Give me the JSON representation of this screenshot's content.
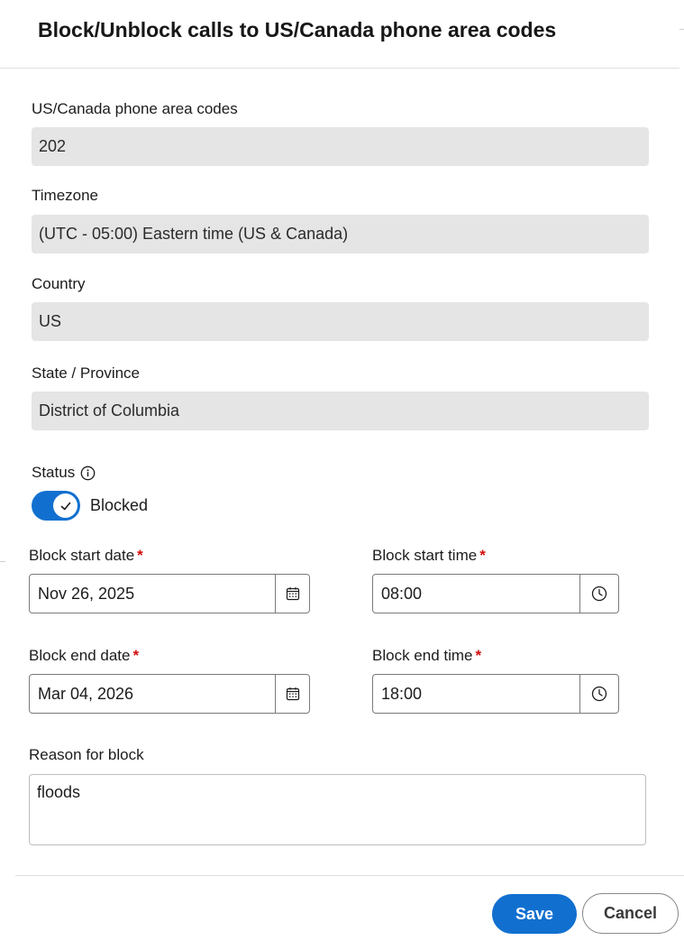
{
  "dialog": {
    "title": "Block/Unblock calls to US/Canada phone area codes"
  },
  "fields": {
    "area_code": {
      "label": "US/Canada phone area codes",
      "value": "202"
    },
    "timezone": {
      "label": "Timezone",
      "value": "(UTC - 05:00) Eastern time (US & Canada)"
    },
    "country": {
      "label": "Country",
      "value": "US"
    },
    "state": {
      "label": "State / Province",
      "value": "District of Columbia"
    }
  },
  "status": {
    "label": "Status",
    "info_icon": "info-icon",
    "toggle_on": true,
    "toggle_text": "Blocked"
  },
  "schedule": {
    "start_date": {
      "label": "Block start date",
      "required_mark": "*",
      "value": "Nov 26, 2025",
      "icon": "calendar-icon"
    },
    "start_time": {
      "label": "Block start time",
      "required_mark": "*",
      "value": "08:00",
      "icon": "clock-icon"
    },
    "end_date": {
      "label": "Block end date",
      "required_mark": "*",
      "value": "Mar 04, 2026",
      "icon": "calendar-icon"
    },
    "end_time": {
      "label": "Block end time",
      "required_mark": "*",
      "value": "18:00",
      "icon": "clock-icon"
    }
  },
  "reason": {
    "label": "Reason for block",
    "value": "floods"
  },
  "actions": {
    "save_label": "Save",
    "cancel_label": "Cancel"
  },
  "colors": {
    "primary": "#1170cf",
    "required": "#d20e0e",
    "readonly_bg": "#e5e5e5"
  }
}
